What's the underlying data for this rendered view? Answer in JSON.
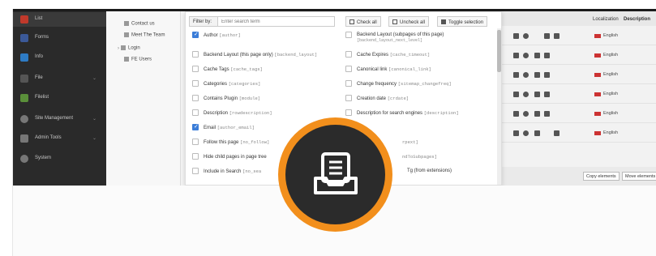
{
  "sidebar": {
    "items": [
      {
        "label": "List",
        "icon": "list-icon",
        "color": "#c0392b"
      },
      {
        "label": "Forms",
        "icon": "forms-icon",
        "color": "#3b5998"
      },
      {
        "label": "Info",
        "icon": "info-icon",
        "color": "#2e7bc4"
      },
      {
        "label": "File",
        "icon": "file-icon",
        "color": "#555555"
      },
      {
        "label": "Filelist",
        "icon": "filelist-icon",
        "color": "#5a8f3a"
      },
      {
        "label": "Site Management",
        "icon": "site-management-icon",
        "color": "#777777"
      },
      {
        "label": "Admin Tools",
        "icon": "admin-tools-icon",
        "color": "#777777"
      },
      {
        "label": "System",
        "icon": "system-icon",
        "color": "#777777"
      }
    ]
  },
  "tree": {
    "items": [
      {
        "label": "Contact us"
      },
      {
        "label": "Meet The Team"
      },
      {
        "label": "Login"
      },
      {
        "label": "FE Users"
      }
    ]
  },
  "panel": {
    "filter_label": "Filter by:",
    "filter_placeholder": "Enter search term",
    "check_all": "Check all",
    "uncheck_all": "Uncheck all",
    "toggle_selection": "Toggle selection",
    "left_fields": [
      {
        "label": "Author",
        "key": "[author]",
        "checked": true
      },
      {
        "label": "Backend Layout (this page only)",
        "key": "[backend_layout]",
        "checked": false
      },
      {
        "label": "Cache Tags",
        "key": "[cache_tags]",
        "checked": false
      },
      {
        "label": "Categories",
        "key": "[categories]",
        "checked": false
      },
      {
        "label": "Contains Plugin",
        "key": "[module]",
        "checked": false
      },
      {
        "label": "Description",
        "key": "[rowdescription]",
        "checked": false
      },
      {
        "label": "Email",
        "key": "[author_email]",
        "checked": true
      },
      {
        "label": "Follow this page",
        "key": "[no_follow]",
        "checked": false
      },
      {
        "label": "Hide child pages in page tree",
        "key": "",
        "checked": false
      },
      {
        "label": "Include in Search",
        "key": "[no_sea",
        "checked": false
      }
    ],
    "right_fields": [
      {
        "label": "Backend Layout (subpages of this page)",
        "key": "[backend_layout_next_level]",
        "checked": false
      },
      {
        "label": "Cache Expires",
        "key": "[cache_timeout]",
        "checked": false
      },
      {
        "label": "Canonical link",
        "key": "[canonical_link]",
        "checked": false
      },
      {
        "label": "Change frequency",
        "key": "[sitemap_changefreq]",
        "checked": false
      },
      {
        "label": "Creation date",
        "key": "[crdate]",
        "checked": false
      },
      {
        "label": "Description for search engines",
        "key": "[description]",
        "checked": false
      },
      {
        "label": "",
        "key": "rpext]",
        "checked": false
      },
      {
        "label": "",
        "key": "ndToSubpages]",
        "checked": false
      },
      {
        "label": "Tg (from extensions)",
        "key": "",
        "checked": false
      }
    ]
  },
  "list": {
    "col_localization": "Localization",
    "col_description": "Description",
    "rows": [
      {
        "language": "English"
      },
      {
        "language": "English"
      },
      {
        "language": "English"
      },
      {
        "language": "English"
      },
      {
        "language": "English"
      },
      {
        "language": "English"
      }
    ],
    "copy_elements": "Copy elements",
    "move_elements": "Move elements"
  },
  "badge": {
    "icon": "inbox-document-icon",
    "ring_color": "#f28f1c",
    "core_color": "#2b2b2b"
  }
}
